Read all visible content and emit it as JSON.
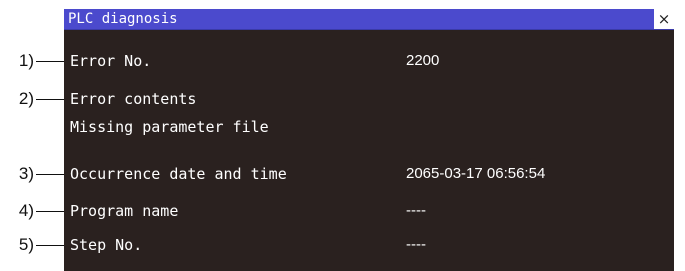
{
  "window": {
    "title": "PLC diagnosis",
    "close_label": "×"
  },
  "annotations": [
    "1)",
    "2)",
    "3)",
    "4)",
    "5)"
  ],
  "fields": {
    "error_no": {
      "label": "Error No.",
      "value": "2200"
    },
    "error_contents": {
      "label": "Error contents",
      "detail": "Missing parameter file"
    },
    "occurrence": {
      "label": "Occurrence date and time",
      "value": "2065-03-17 06:56:54"
    },
    "program_name": {
      "label": "Program name",
      "value": "----"
    },
    "step_no": {
      "label": "Step No.",
      "value": "----"
    }
  },
  "colors": {
    "titlebar": "#4b4acd",
    "panel_background": "#2a211f",
    "text": "#ffffff"
  }
}
